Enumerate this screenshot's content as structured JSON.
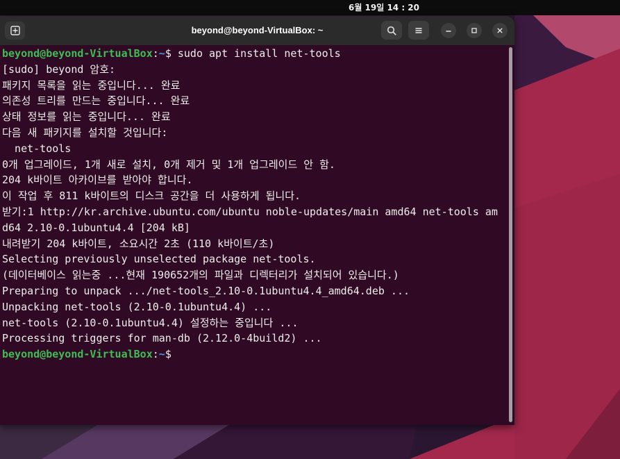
{
  "topbar": {
    "clock": "6월 19일 14 : 20"
  },
  "window": {
    "title": "beyond@beyond-VirtualBox: ~",
    "icons": {
      "new_tab": "new-tab-icon",
      "search": "search-icon",
      "menu": "hamburger-menu-icon",
      "minimize": "minimize-icon",
      "maximize": "maximize-icon",
      "close": "close-icon"
    }
  },
  "terminal": {
    "prompt": {
      "user_host": "beyond@beyond-VirtualBox",
      "separator": ":",
      "path": "~",
      "symbol": "$"
    },
    "command": "sudo apt install net-tools",
    "output": [
      "[sudo] beyond 암호:",
      "패키지 목록을 읽는 중입니다... 완료",
      "의존성 트리를 만드는 중입니다... 완료",
      "상태 정보를 읽는 중입니다... 완료",
      "다음 새 패키지를 설치할 것입니다:",
      "  net-tools",
      "0개 업그레이드, 1개 새로 설치, 0개 제거 및 1개 업그레이드 안 함.",
      "204 k바이트 아카이브를 받아야 합니다.",
      "이 작업 후 811 k바이트의 디스크 공간을 더 사용하게 됩니다.",
      "받기:1 http://kr.archive.ubuntu.com/ubuntu noble-updates/main amd64 net-tools am",
      "d64 2.10-0.1ubuntu4.4 [204 kB]",
      "내려받기 204 k바이트, 소요시간 2초 (110 k바이트/초)",
      "Selecting previously unselected package net-tools.",
      "(데이터베이스 읽는중 ...현재 190652개의 파일과 디렉터리가 설치되어 있습니다.)",
      "Preparing to unpack .../net-tools_2.10-0.1ubuntu4.4_amd64.deb ...",
      "Unpacking net-tools (2.10-0.1ubuntu4.4) ...",
      "net-tools (2.10-0.1ubuntu4.4) 설정하는 중입니다 ...",
      "Processing triggers for man-db (2.12.0-4build2) ..."
    ]
  },
  "colors": {
    "terminal_background": "#300a24",
    "terminal_foreground": "#eeeeec",
    "prompt_user_host": "#3fbd54",
    "prompt_path": "#4a90e2",
    "header_background": "#2b2b2b",
    "topbar_background": "#0c0c0c"
  }
}
